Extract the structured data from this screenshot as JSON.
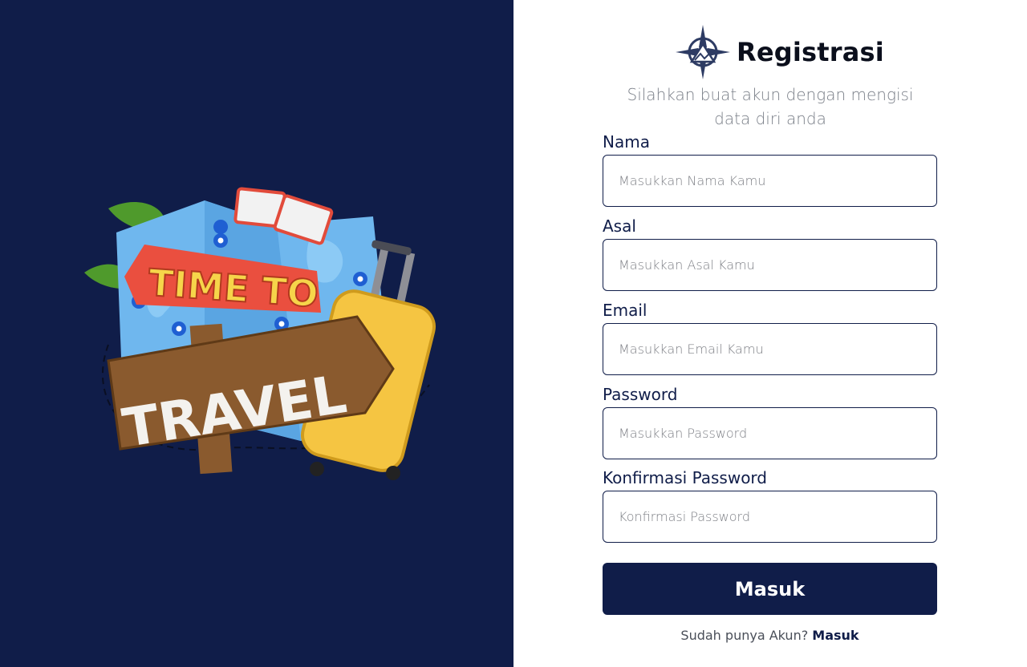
{
  "brand": {
    "title": "Registrasi",
    "subtitle": "Silahkan buat akun dengan mengisi data diri anda",
    "logo_icon": "compass-logo-icon"
  },
  "illustration": {
    "icon": "time-to-travel-illustration",
    "line1": "TIME TO",
    "line2": "TRAVEL"
  },
  "form": {
    "fields": [
      {
        "label": "Nama",
        "placeholder": "Masukkan Nama Kamu"
      },
      {
        "label": "Asal",
        "placeholder": "Masukkan Asal Kamu"
      },
      {
        "label": "Email",
        "placeholder": "Masukkan Email Kamu"
      },
      {
        "label": "Password",
        "placeholder": "Masukkan Password"
      },
      {
        "label": "Konfirmasi Password",
        "placeholder": "Konfirmasi Password"
      }
    ],
    "submit_label": "Masuk"
  },
  "footer": {
    "prompt": "Sudah punya Akun?",
    "link_label": "Masuk"
  },
  "colors": {
    "navy": "#101d49",
    "white": "#ffffff",
    "muted_text": "#7a7f88"
  }
}
